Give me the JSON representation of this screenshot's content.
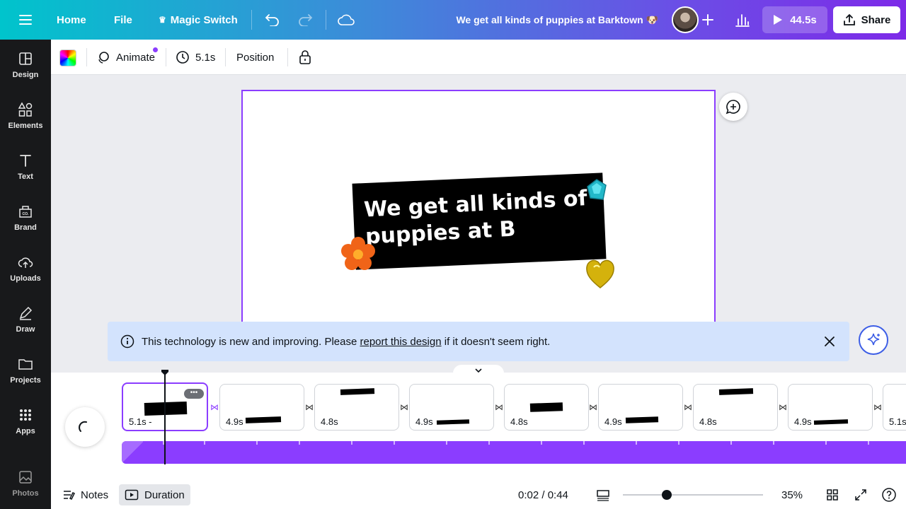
{
  "topbar": {
    "menu_icon": "hamburger-icon",
    "home": "Home",
    "file": "File",
    "magic_switch": "Magic Switch",
    "title": "We get all kinds of puppies at Barktown 🐶",
    "play_duration": "44.5s",
    "share": "Share",
    "gradient_colors": [
      "#00c4cc",
      "#7d2ae8"
    ]
  },
  "sidebar": {
    "items": [
      {
        "label": "Design",
        "icon": "layout-icon"
      },
      {
        "label": "Elements",
        "icon": "shapes-icon"
      },
      {
        "label": "Text",
        "icon": "text-icon"
      },
      {
        "label": "Brand",
        "icon": "brand-icon"
      },
      {
        "label": "Uploads",
        "icon": "cloud-upload-icon"
      },
      {
        "label": "Draw",
        "icon": "pen-icon"
      },
      {
        "label": "Projects",
        "icon": "folder-icon"
      },
      {
        "label": "Apps",
        "icon": "grid-icon"
      },
      {
        "label": "Photos",
        "icon": "image-icon"
      }
    ]
  },
  "context_toolbar": {
    "animate": "Animate",
    "duration": "5.1s",
    "position": "Position"
  },
  "canvas": {
    "banner_text": "We get all kinds of puppies at B",
    "accent_color": "#8b3dff"
  },
  "notice": {
    "text_before": "This technology is new and improving. Please ",
    "link": "report this design",
    "text_after": " if it doesn't seem right."
  },
  "timeline": {
    "clips": [
      {
        "duration": "5.1s -"
      },
      {
        "duration": "4.9s"
      },
      {
        "duration": "4.8s"
      },
      {
        "duration": "4.9s"
      },
      {
        "duration": "4.8s"
      },
      {
        "duration": "4.9s"
      },
      {
        "duration": "4.8s"
      },
      {
        "duration": "4.9s"
      },
      {
        "duration": "5.1s"
      }
    ]
  },
  "bottombar": {
    "notes": "Notes",
    "duration": "Duration",
    "time": "0:02 / 0:44",
    "zoom": "35%",
    "zoom_level": 0.35
  }
}
